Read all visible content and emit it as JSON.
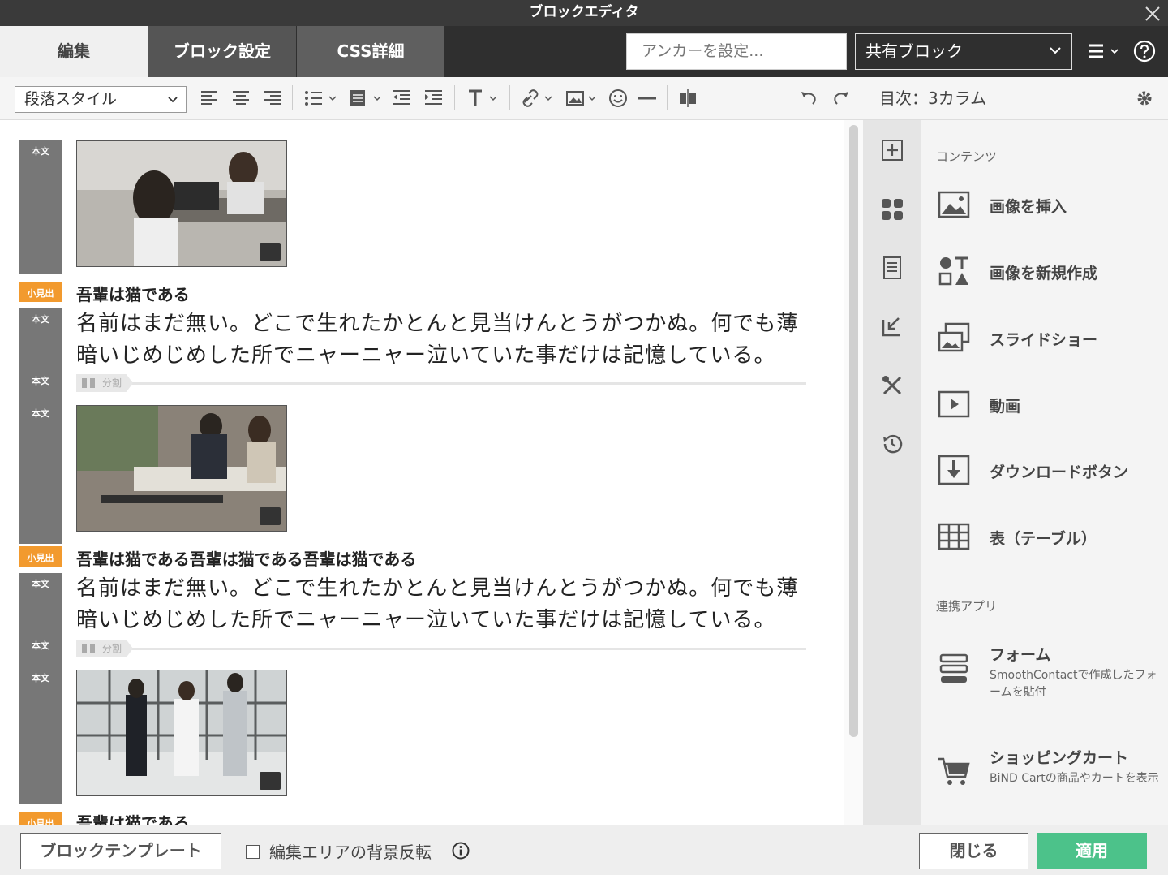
{
  "window": {
    "title": "ブロックエディタ"
  },
  "tabs": [
    {
      "label": "編集",
      "active": true
    },
    {
      "label": "ブロック設定"
    },
    {
      "label": "CSS詳細"
    }
  ],
  "anchor": {
    "placeholder": "アンカーを設定..."
  },
  "shared_block": {
    "value": "共有ブロック"
  },
  "toolbar": {
    "paragraph_style": "段落スタイル"
  },
  "side_header": {
    "title": "目次：3カラム"
  },
  "editor": {
    "label_body": "本文",
    "label_heading": "小見出",
    "split_label": "分割",
    "headings": [
      "吾輩は猫である",
      "吾輩は猫である吾輩は猫である吾輩は猫である",
      "吾輩は猫である"
    ],
    "paragraphs": [
      [
        "名前はまだ無い。どこで生れたかとんと見当けんとうがつかぬ。何でも薄",
        "暗いじめじめした所でニャーニャー泣いていた事だけは記憶している。"
      ],
      [
        "名前はまだ無い。どこで生れたかとんと見当けんとうがつかぬ。何でも薄",
        "暗いじめじめした所でニャーニャー泣いていた事だけは記憶している。"
      ]
    ]
  },
  "sidebar": {
    "section_contents": "コンテンツ",
    "items": [
      {
        "label": "画像を挿入",
        "icon": "image-icon"
      },
      {
        "label": "画像を新規作成",
        "icon": "image-create-icon"
      },
      {
        "label": "スライドショー",
        "icon": "slideshow-icon"
      },
      {
        "label": "動画",
        "icon": "video-icon"
      },
      {
        "label": "ダウンロードボタン",
        "icon": "download-icon"
      },
      {
        "label": "表（テーブル）",
        "icon": "table-icon"
      }
    ],
    "section_apps": "連携アプリ",
    "apps": [
      {
        "label": "フォーム",
        "desc": "SmoothContactで作成したフォームを貼付",
        "icon": "form-icon"
      },
      {
        "label": "ショッピングカート",
        "desc": "BiND Cartの商品やカートを表示",
        "icon": "cart-icon"
      }
    ]
  },
  "footer": {
    "template_button": "ブロックテンプレート",
    "invert_bg_label": "編集エリアの背景反転",
    "close_button": "閉じる",
    "apply_button": "適用"
  },
  "colors": {
    "accent_green": "#4cc28a",
    "heading_label": "#f29a2e",
    "body_label": "#777777",
    "dark_bar": "#2f2f2f"
  }
}
